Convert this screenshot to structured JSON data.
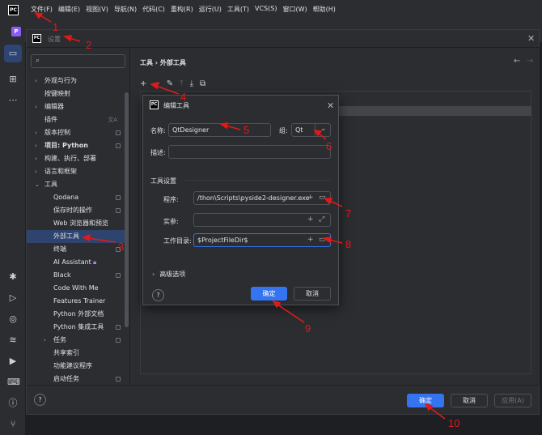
{
  "menubar": {
    "logo": "PC",
    "items": [
      "文件(F)",
      "编辑(E)",
      "视图(V)",
      "导航(N)",
      "代码(C)",
      "重构(R)",
      "运行(U)",
      "工具(T)",
      "VCS(S)",
      "窗口(W)",
      "帮助(H)"
    ]
  },
  "project_badge": "P",
  "settings": {
    "logo": "PC",
    "title": "设置",
    "search_placeholder": "",
    "tree": [
      {
        "label": "外观与行为",
        "arrow": "›"
      },
      {
        "label": "按键映射",
        "arrow": ""
      },
      {
        "label": "编辑器",
        "arrow": "›"
      },
      {
        "label": "插件",
        "arrow": ""
      },
      {
        "label": "版本控制",
        "arrow": "›"
      },
      {
        "label": "项目: Python",
        "arrow": "›"
      },
      {
        "label": "构建、执行、部署",
        "arrow": "›"
      },
      {
        "label": "语言和框架",
        "arrow": "›"
      },
      {
        "label": "工具",
        "arrow": "⌄"
      },
      {
        "label": "Qodana",
        "arrow": ""
      },
      {
        "label": "保存时的操作",
        "arrow": ""
      },
      {
        "label": "Web 浏览器和预览",
        "arrow": ""
      },
      {
        "label": "外部工具",
        "arrow": ""
      },
      {
        "label": "终端",
        "arrow": ""
      },
      {
        "label": "AI Assistant",
        "arrow": ""
      },
      {
        "label": "Black",
        "arrow": ""
      },
      {
        "label": "Code With Me",
        "arrow": ""
      },
      {
        "label": "Features Trainer",
        "arrow": ""
      },
      {
        "label": "Python 外部文档",
        "arrow": ""
      },
      {
        "label": "Python 集成工具",
        "arrow": ""
      },
      {
        "label": "任务",
        "arrow": "›"
      },
      {
        "label": "共享索引",
        "arrow": ""
      },
      {
        "label": "功能建议程序",
        "arrow": ""
      },
      {
        "label": "启动任务",
        "arrow": ""
      }
    ],
    "breadcrumb": "工具  ›  外部工具",
    "footer": {
      "help": "?",
      "ok": "确定",
      "cancel": "取消",
      "apply": "应用(A)"
    }
  },
  "edit_tool": {
    "logo": "PC",
    "title": "编辑工具",
    "name_label": "名称:",
    "name_value": "QtDesigner",
    "group_label": "组:",
    "group_value": "Qt",
    "desc_label": "描述:",
    "desc_value": "",
    "section_title": "工具设置",
    "program_label": "程序:",
    "program_value": "/thon\\Scripts\\pyside2-designer.exe",
    "args_label": "实参:",
    "args_value": "",
    "workdir_label": "工作目录:",
    "workdir_value": "$ProjectFileDir$",
    "advanced_label": "高级选项",
    "help": "?",
    "ok": "确定",
    "cancel": "取消"
  },
  "annotations": [
    "1",
    "2",
    "3",
    "4",
    "5",
    "6",
    "7",
    "8",
    "9",
    "10"
  ],
  "colors": {
    "background": "#1e1f22",
    "panel": "#2b2d30",
    "accent": "#3574f0",
    "selected": "#2e436e",
    "annotation": "#e01a1a"
  }
}
